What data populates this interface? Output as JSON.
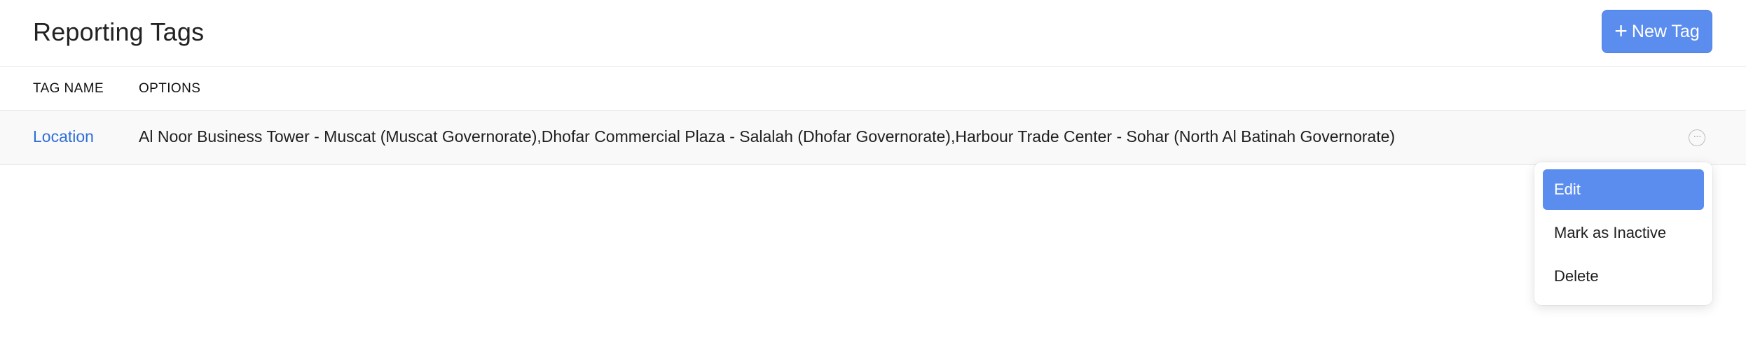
{
  "header": {
    "title": "Reporting Tags",
    "new_tag_label": "New Tag",
    "new_tag_icon": "plus-icon"
  },
  "table": {
    "columns": [
      "TAG NAME",
      "OPTIONS"
    ],
    "rows": [
      {
        "tag_name": "Location",
        "options": "Al Noor Business Tower - Muscat (Muscat Governorate),Dhofar Commercial Plaza - Salalah (Dhofar Governorate),Harbour Trade Center - Sohar (North Al Batinah Governorate)",
        "actions_icon": "more-horizontal-icon"
      }
    ]
  },
  "dropdown": {
    "items": [
      "Edit",
      "Mark as Inactive",
      "Delete"
    ],
    "active_item": "Edit"
  },
  "colors": {
    "primary": "#5b8def",
    "link": "#2f6fd6"
  }
}
